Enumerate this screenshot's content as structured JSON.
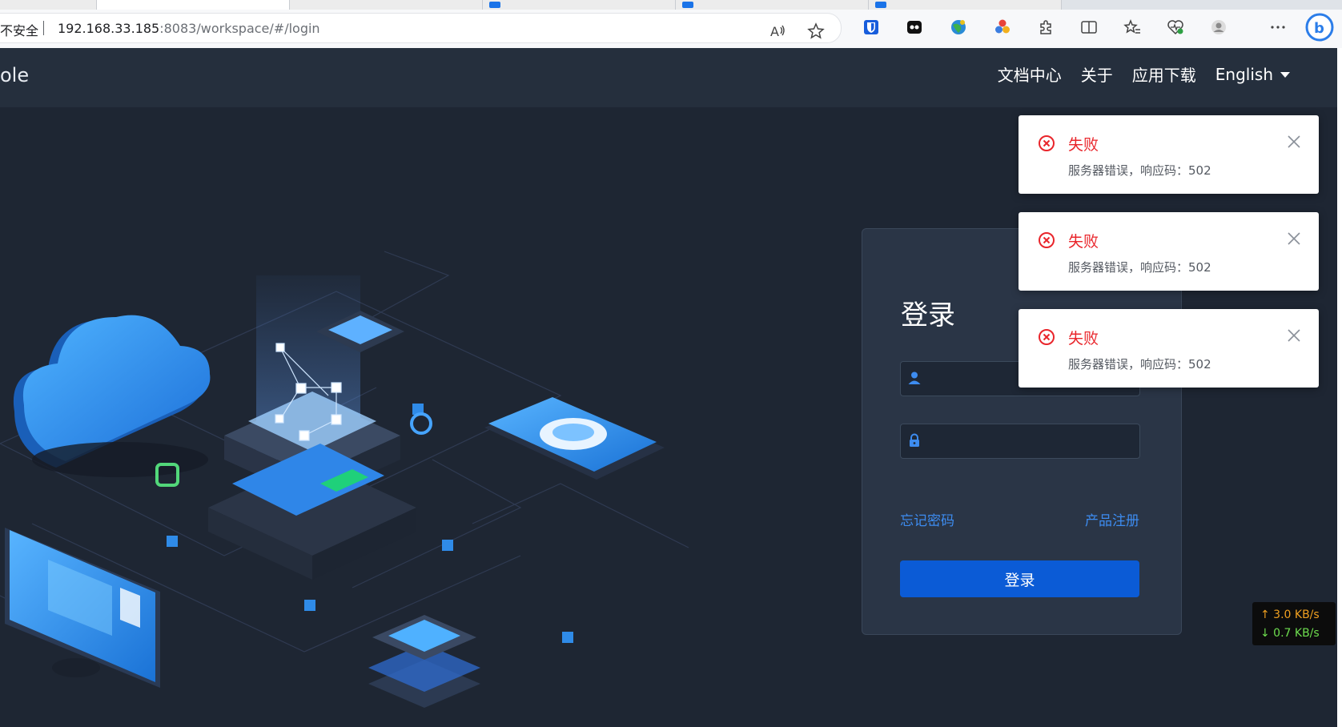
{
  "browser": {
    "security_label": "不安全",
    "url_host": "192.168.33.185",
    "url_rest": ":8083/workspace/#/login",
    "icons": [
      "read-aloud-icon",
      "favorite-star-icon",
      "bitwarden-icon",
      "extension-icon",
      "extension-globe-icon",
      "extension-color-icon",
      "extensions-puzzle-icon",
      "split-screen-icon",
      "favorites-icon",
      "browser-essentials-icon",
      "profile-icon",
      "more-icon",
      "copilot-icon"
    ]
  },
  "header": {
    "brand": "ole",
    "nav": [
      "文档中心",
      "关于",
      "应用下载"
    ],
    "language": "English"
  },
  "login": {
    "title": "登录",
    "username_value": "",
    "password_value": "",
    "forgot_password": "忘记密码",
    "register": "产品注册",
    "submit": "登录"
  },
  "notifications": [
    {
      "title": "失败",
      "message": "服务器错误，响应码：502"
    },
    {
      "title": "失败",
      "message": "服务器错误，响应码：502"
    },
    {
      "title": "失败",
      "message": "服务器错误，响应码：502"
    }
  ],
  "netspeed": {
    "up": "↑ 3.0 KB/s",
    "down": "↓ 0.7 KB/s"
  },
  "colors": {
    "accent": "#0b5bd6",
    "link": "#3d8cf0",
    "error": "#e9252b",
    "page_bg": "#1e2633"
  }
}
